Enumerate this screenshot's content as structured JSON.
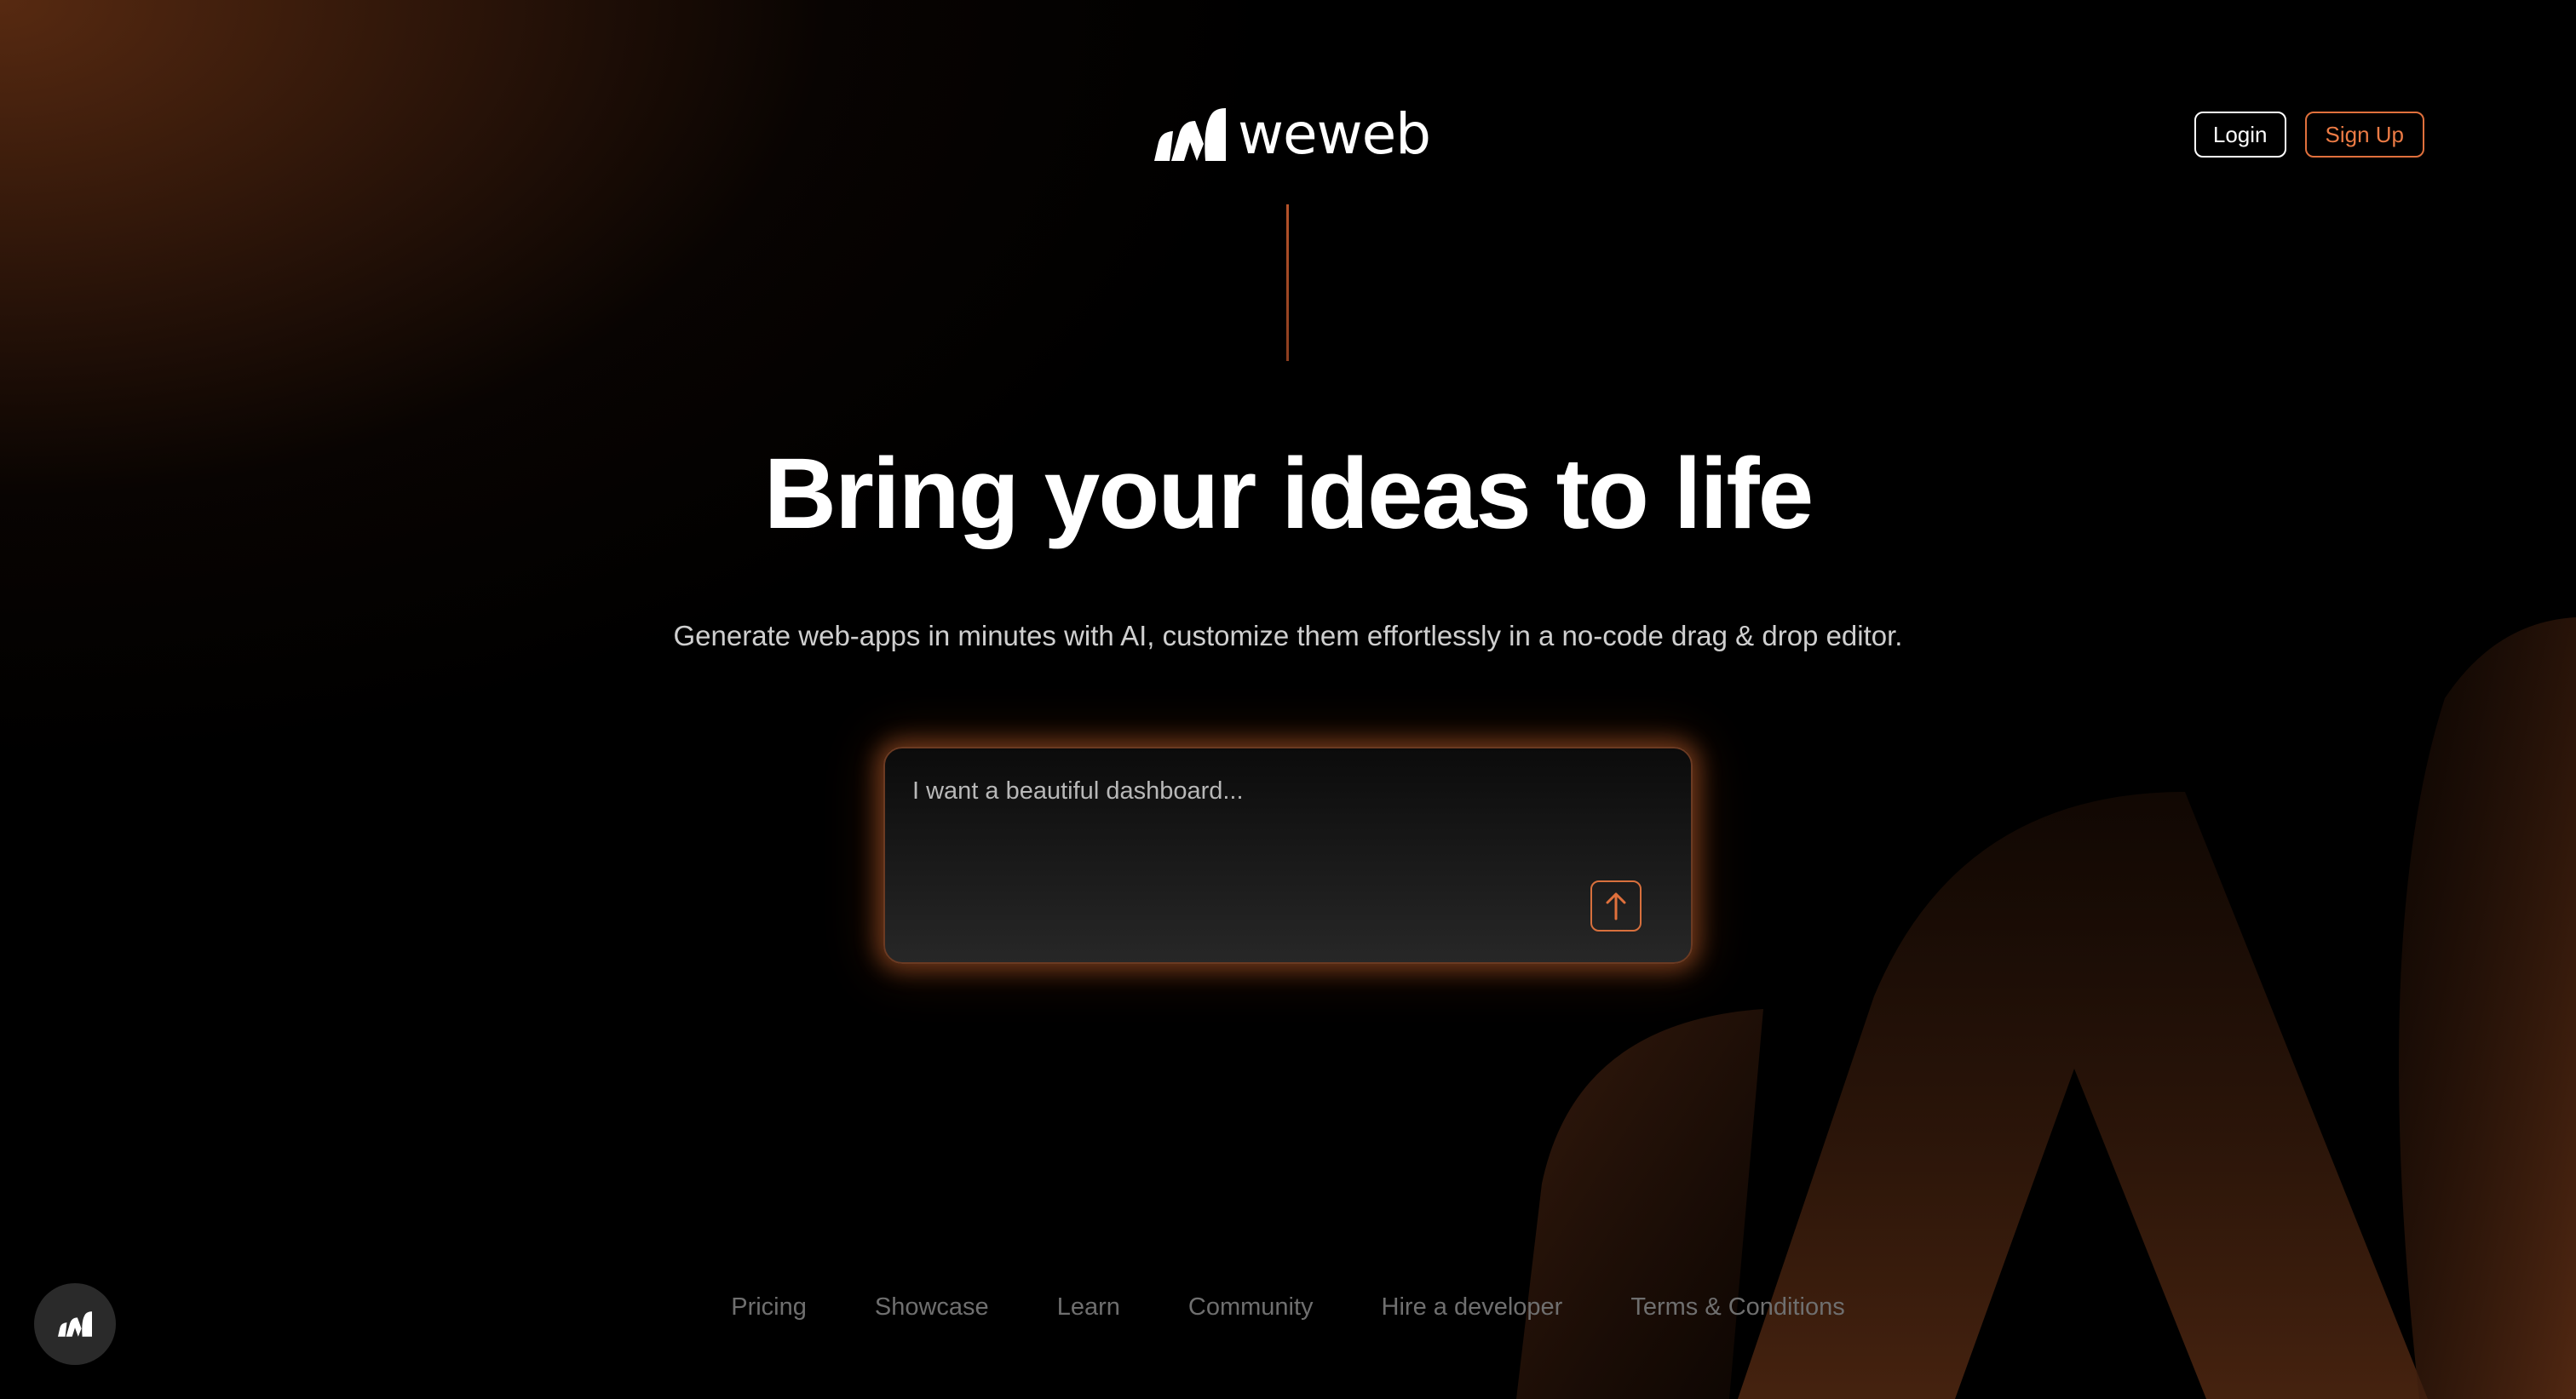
{
  "brand": {
    "logo_text": "weweb",
    "logo_icon": "weweb-logo-icon",
    "accent_color": "#e0703c"
  },
  "header": {
    "login_label": "Login",
    "signup_label": "Sign Up"
  },
  "hero": {
    "title": "Bring your ideas to life",
    "subtitle": "Generate web-apps in minutes with AI, customize them effortlessly in a no-code drag & drop editor."
  },
  "prompt": {
    "placeholder": "I want a beautiful dashboard...",
    "value": "",
    "submit_icon": "arrow-up-icon"
  },
  "footer": {
    "links": [
      {
        "label": "Pricing"
      },
      {
        "label": "Showcase"
      },
      {
        "label": "Learn"
      },
      {
        "label": "Community"
      },
      {
        "label": "Hire a developer"
      },
      {
        "label": "Terms & Conditions"
      }
    ]
  },
  "floating_button": {
    "icon": "weweb-logo-icon"
  }
}
